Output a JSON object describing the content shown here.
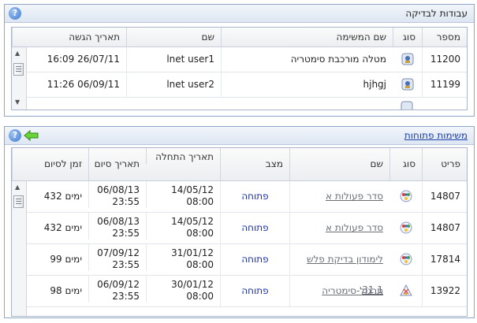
{
  "panel1": {
    "title": "עבודות לבדיקה",
    "help_label": "?",
    "columns": [
      "מספר",
      "סוג",
      "שם המשימה",
      "שם",
      "תאריך הגשה"
    ],
    "rows": [
      {
        "number": "11200",
        "task": "מטלה מורכבת סימטריה",
        "name": "lnet user1",
        "date": "16:09 26/07/11"
      },
      {
        "number": "11199",
        "task": "hjhgj",
        "name": "lnet user2",
        "date": "11:26 06/09/11"
      }
    ]
  },
  "panel2": {
    "title": "משימות פתוחות",
    "help_label": "?",
    "columns": [
      "פריט",
      "סוג",
      "שם",
      "מצב",
      "תאריך התחלה",
      "תאריך סיום",
      "זמן לסיום"
    ],
    "rows": [
      {
        "item": "14807",
        "name": "סדר פעולות א",
        "status": "פתוחה",
        "start_date": "14/05/12",
        "start_time": "08:00",
        "end_date": "06/08/13",
        "end_time": "23:55",
        "remaining": "432 ימים",
        "icon": "colored-dots-icon"
      },
      {
        "item": "14807",
        "name": "סדר פעולות א",
        "status": "פתוחה",
        "start_date": "14/05/12",
        "start_time": "08:00",
        "end_date": "06/08/13",
        "end_time": "23:55",
        "remaining": "432 ימים",
        "icon": "colored-dots-icon"
      },
      {
        "item": "17814",
        "name": "לימודון בדיקת פלש 31.1",
        "status": "פתוחה",
        "start_date": "31/01/12",
        "start_time": "08:00",
        "end_date": "07/09/12",
        "end_time": "23:55",
        "remaining": "99 ימים",
        "icon": "colored-dots-icon"
      },
      {
        "item": "13922",
        "name": "תרגול-סימטריה",
        "status": "פתוחה",
        "start_date": "30/01/12",
        "start_time": "08:00",
        "end_date": "06/09/12",
        "end_time": "23:55",
        "remaining": "98 ימים",
        "icon": "symmetry-icon"
      }
    ]
  }
}
